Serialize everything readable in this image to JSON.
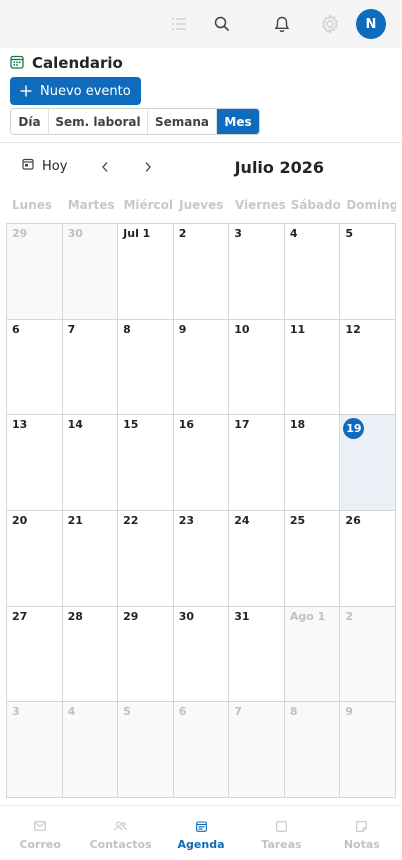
{
  "topbar": {
    "icons": [
      "list-icon",
      "search-icon",
      "bell-icon",
      "gear-icon"
    ],
    "avatar_initial": "N"
  },
  "app": {
    "title": "Calendario",
    "icon": "calendar-icon"
  },
  "toolbar": {
    "new_event_label": "Nuevo evento"
  },
  "views": [
    {
      "label": "Día",
      "active": false
    },
    {
      "label": "Sem. laboral",
      "active": false
    },
    {
      "label": "Semana",
      "active": false
    },
    {
      "label": "Mes",
      "active": true
    }
  ],
  "nav": {
    "today_label": "Hoy",
    "month_title": "Julio 2026"
  },
  "weekdays": [
    "Lunes",
    "Martes",
    "Miércoles",
    "Jueves",
    "Viernes",
    "Sábado",
    "Domingo"
  ],
  "calendar": {
    "weeks": [
      [
        {
          "n": "29",
          "o": true
        },
        {
          "n": "30",
          "o": true
        },
        {
          "n": "Jul 1"
        },
        {
          "n": "2"
        },
        {
          "n": "3"
        },
        {
          "n": "4"
        },
        {
          "n": "5"
        }
      ],
      [
        {
          "n": "6"
        },
        {
          "n": "7"
        },
        {
          "n": "8"
        },
        {
          "n": "9"
        },
        {
          "n": "10"
        },
        {
          "n": "11"
        },
        {
          "n": "12"
        }
      ],
      [
        {
          "n": "13"
        },
        {
          "n": "14"
        },
        {
          "n": "15"
        },
        {
          "n": "16"
        },
        {
          "n": "17"
        },
        {
          "n": "18"
        },
        {
          "n": "19",
          "t": true
        }
      ],
      [
        {
          "n": "20"
        },
        {
          "n": "21"
        },
        {
          "n": "22"
        },
        {
          "n": "23"
        },
        {
          "n": "24"
        },
        {
          "n": "25"
        },
        {
          "n": "26"
        }
      ],
      [
        {
          "n": "27"
        },
        {
          "n": "28"
        },
        {
          "n": "29"
        },
        {
          "n": "30"
        },
        {
          "n": "31"
        },
        {
          "n": "Ago 1",
          "o": true
        },
        {
          "n": "2",
          "o": true
        }
      ],
      [
        {
          "n": "3",
          "o": true
        },
        {
          "n": "4",
          "o": true
        },
        {
          "n": "5",
          "o": true
        },
        {
          "n": "6",
          "o": true
        },
        {
          "n": "7",
          "o": true
        },
        {
          "n": "8",
          "o": true
        },
        {
          "n": "9",
          "o": true
        }
      ]
    ]
  },
  "bottom_nav": [
    {
      "label": "Correo",
      "icon": "mail-icon",
      "active": false
    },
    {
      "label": "Contactos",
      "icon": "people-icon",
      "active": false
    },
    {
      "label": "Agenda",
      "icon": "calendar-icon",
      "active": true
    },
    {
      "label": "Tareas",
      "icon": "task-icon",
      "active": false
    },
    {
      "label": "Notas",
      "icon": "note-icon",
      "active": false
    }
  ],
  "colors": {
    "accent": "#0f6cbd",
    "today_bg": "#ebf0f7",
    "outside_month_bg": "#faf9f8"
  }
}
